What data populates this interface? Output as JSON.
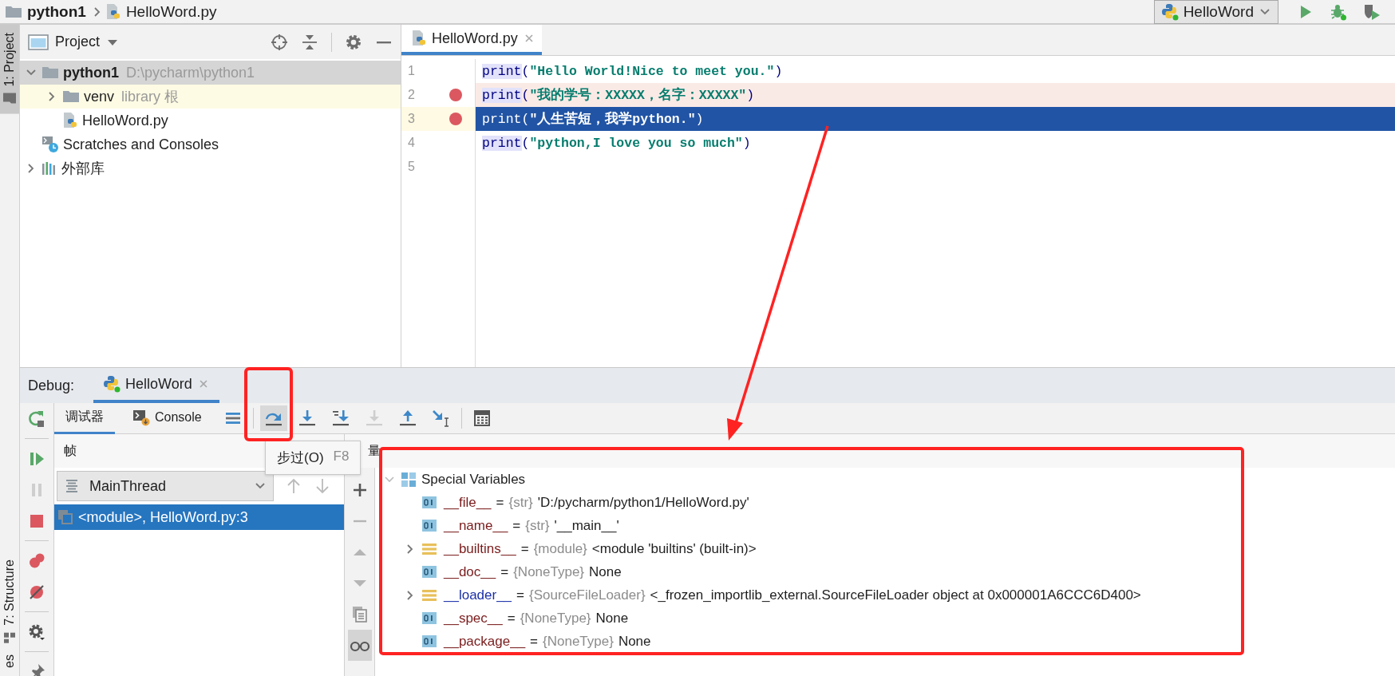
{
  "breadcrumb": [
    {
      "label": "python1",
      "kind": "project"
    },
    {
      "label": "HelloWord.py",
      "kind": "python"
    }
  ],
  "run_config": {
    "label": "HelloWord"
  },
  "left_stripe": [
    {
      "label": "1: Project",
      "kind": "project",
      "selected": true
    },
    {
      "label": "7: Structure",
      "kind": "structure",
      "selected": false
    },
    {
      "label": "es",
      "kind": "plain",
      "selected": false
    }
  ],
  "project_panel": {
    "title": "Project",
    "tree": [
      {
        "label": "python1",
        "hint": "D:\\pycharm\\python1",
        "kind": "project",
        "selected": true,
        "expanded": true,
        "children": [
          {
            "label": "venv",
            "hint": "library 根",
            "kind": "library",
            "selected": false,
            "expanded": false
          },
          {
            "label": "HelloWord.py",
            "kind": "python",
            "selected": false
          }
        ]
      },
      {
        "label": "Scratches and Consoles",
        "kind": "scratch",
        "selected": false
      },
      {
        "label": "外部库",
        "kind": "libraries",
        "selected": false,
        "expanded": false
      }
    ]
  },
  "editor": {
    "tabs": [
      {
        "label": "HelloWord.py",
        "selected": true
      }
    ],
    "lines": [
      {
        "number": "1",
        "func": "print",
        "open": "(",
        "string": "\"Hello World!Nice to meet you.\"",
        "close": ")",
        "breakpoint": false,
        "selected": false
      },
      {
        "number": "2",
        "func": "print",
        "open": "(",
        "string": "\"我的学号：XXXXX，名字：XXXXX\"",
        "close": ")",
        "breakpoint": true,
        "selected": false
      },
      {
        "number": "3",
        "func": "print",
        "open": "(",
        "string": "\"人生苦短，我学python.\"",
        "close": ")",
        "breakpoint": true,
        "selected": true
      },
      {
        "number": "4",
        "func": "print",
        "open": "(",
        "string": "\"python,I love you so much\"",
        "close": ")",
        "breakpoint": false,
        "selected": false
      },
      {
        "number": "5",
        "breakpoint": false,
        "selected": false
      }
    ]
  },
  "debug": {
    "label": "Debug:",
    "tabs": [
      {
        "label": "HelloWord",
        "selected": true
      }
    ],
    "side_toolbar": [
      [
        {
          "kind": "rerun",
          "disabled": false
        }
      ],
      [
        {
          "kind": "resume",
          "disabled": false
        },
        {
          "kind": "pause",
          "disabled": true
        },
        {
          "kind": "stop",
          "disabled": false
        }
      ],
      [
        {
          "kind": "view-breakpoints",
          "disabled": false
        },
        {
          "kind": "mute-breakpoints",
          "disabled": false
        }
      ],
      [
        {
          "kind": "settings",
          "disabled": false
        }
      ],
      [
        {
          "kind": "pin",
          "disabled": false
        }
      ]
    ],
    "subtabs": [
      {
        "label": "调试器",
        "kind": "debugger",
        "selected": true
      },
      {
        "label": "Console",
        "kind": "console",
        "selected": false
      }
    ],
    "toolbar": [
      [
        {
          "kind": "menu",
          "selected": false,
          "disabled": false
        }
      ],
      [
        {
          "kind": "step-over",
          "selected": true,
          "disabled": false
        },
        {
          "kind": "step-into",
          "selected": false,
          "disabled": false
        },
        {
          "kind": "step-into-my-code",
          "selected": false,
          "disabled": false
        },
        {
          "kind": "force-step-into",
          "selected": false,
          "disabled": true
        },
        {
          "kind": "step-out",
          "selected": false,
          "disabled": false
        },
        {
          "kind": "run-to-cursor",
          "selected": false,
          "disabled": false
        }
      ],
      [
        {
          "kind": "evaluate",
          "selected": false,
          "disabled": false
        }
      ]
    ],
    "frames": {
      "title": "帧",
      "thread": "MainThread",
      "items": [
        {
          "label": "<module>, HelloWord.py:3",
          "selected": true
        }
      ]
    },
    "variables": {
      "title": "量",
      "items": [
        {
          "label": "Special Variables",
          "kind": "group",
          "expanded": true,
          "children": [
            {
              "name": "__file__",
              "equals": "=",
              "type": "{str}",
              "value": "'D:/pycharm/python1/HelloWord.py'",
              "kind": "value",
              "color": "#7a1b1b"
            },
            {
              "name": "__name__",
              "equals": "=",
              "type": "{str}",
              "value": "'__main__'",
              "kind": "value",
              "color": "#7a1b1b"
            },
            {
              "name": "__builtins__",
              "equals": "=",
              "type": "{module}",
              "value": "<module 'builtins' (built-in)>",
              "kind": "module",
              "color": "#7a1b1b",
              "expanded": false
            },
            {
              "name": "__doc__",
              "equals": "=",
              "type": "{NoneType}",
              "value": "None",
              "kind": "value",
              "color": "#7a1b1b"
            },
            {
              "name": "__loader__",
              "equals": "=",
              "type": "{SourceFileLoader}",
              "value": "<_frozen_importlib_external.SourceFileLoader object at 0x000001A6CCC6D400>",
              "kind": "module",
              "color": "#1b2fa8",
              "expanded": false
            },
            {
              "name": "__spec__",
              "equals": "=",
              "type": "{NoneType}",
              "value": "None",
              "kind": "value",
              "color": "#7a1b1b"
            },
            {
              "name": "__package__",
              "equals": "=",
              "type": "{NoneType}",
              "value": "None",
              "kind": "value",
              "color": "#7a1b1b"
            }
          ]
        }
      ]
    },
    "tooltip": {
      "text": "步过(O)",
      "shortcut": "F8"
    }
  }
}
